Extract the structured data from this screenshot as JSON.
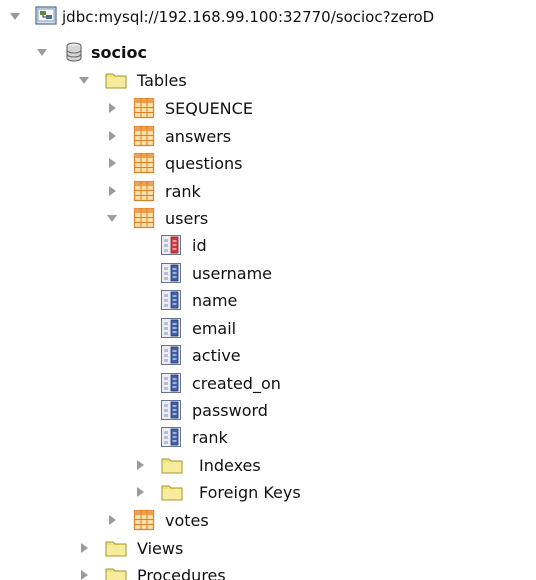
{
  "tree": {
    "connection": {
      "label": "jdbc:mysql://192.168.99.100:32770/socioc?zeroD",
      "icon": "db-connection-icon",
      "expanded": true
    },
    "schema": {
      "label": "socioc",
      "icon": "database-icon",
      "expanded": true
    },
    "tables_folder": {
      "label": "Tables",
      "icon": "folder-icon",
      "expanded": true
    },
    "tables": [
      {
        "label": "SEQUENCE",
        "icon": "table-icon",
        "expanded": false
      },
      {
        "label": "answers",
        "icon": "table-icon",
        "expanded": false
      },
      {
        "label": "questions",
        "icon": "table-icon",
        "expanded": false
      },
      {
        "label": "rank",
        "icon": "table-icon",
        "expanded": false
      },
      {
        "label": "users",
        "icon": "table-icon",
        "expanded": true
      },
      {
        "label": "votes",
        "icon": "table-icon",
        "expanded": false
      }
    ],
    "users_columns": [
      {
        "label": "id",
        "icon": "primary-key-column-icon"
      },
      {
        "label": "username",
        "icon": "column-icon"
      },
      {
        "label": "name",
        "icon": "column-icon"
      },
      {
        "label": "email",
        "icon": "column-icon"
      },
      {
        "label": "active",
        "icon": "column-icon"
      },
      {
        "label": "created_on",
        "icon": "column-icon"
      },
      {
        "label": "password",
        "icon": "column-icon"
      },
      {
        "label": "rank",
        "icon": "column-icon"
      }
    ],
    "users_subfolders": [
      {
        "label": "Indexes",
        "icon": "folder-icon",
        "expanded": false
      },
      {
        "label": "Foreign Keys",
        "icon": "folder-icon",
        "expanded": false
      }
    ],
    "schema_folders": [
      {
        "label": "Views",
        "icon": "folder-icon",
        "expanded": false
      },
      {
        "label": "Procedures",
        "icon": "folder-icon",
        "expanded": false
      }
    ]
  }
}
